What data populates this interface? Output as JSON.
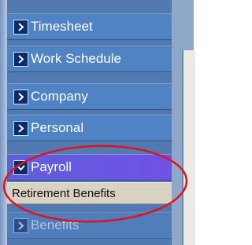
{
  "menu": {
    "items": [
      {
        "label": "Timesheet",
        "icon": "chevron-right-icon"
      },
      {
        "label": "Work Schedule",
        "icon": "chevron-right-icon"
      },
      {
        "label": "Company",
        "icon": "chevron-right-icon"
      },
      {
        "label": "Personal",
        "icon": "chevron-right-icon"
      },
      {
        "label": "Payroll",
        "icon": "chevron-down-icon",
        "state": "expanded"
      },
      {
        "label": "Benefits",
        "icon": "chevron-right-icon"
      }
    ],
    "submenu": {
      "label": "Retirement Benefits"
    }
  },
  "colors": {
    "menu_bg": "#4f83c3",
    "active_bg": "#6a55e2",
    "submenu_bg": "#d8d2c3",
    "annotation": "#e0141f"
  }
}
